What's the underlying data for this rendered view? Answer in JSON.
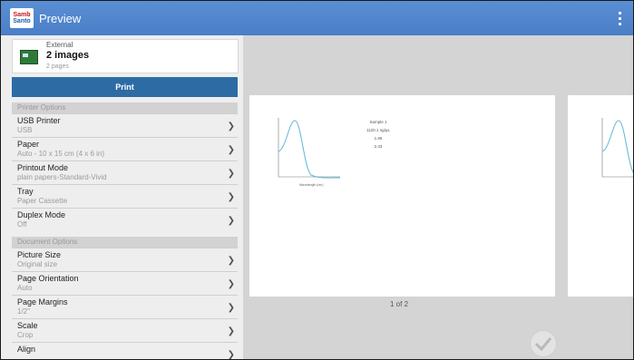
{
  "app": {
    "logo_line1": "Samb",
    "logo_line2": "Santo",
    "title": "Preview"
  },
  "source": {
    "kind": "External",
    "count": "2 images",
    "pages": "2 pages"
  },
  "print_label": "Print",
  "sections": {
    "printer_options": "Printer Options",
    "document_options": "Document Options"
  },
  "printer_rows": [
    {
      "label": "USB Printer",
      "value": "USB"
    },
    {
      "label": "Paper",
      "value": "Auto - 10 x 15 cm (4 x 6 in)"
    },
    {
      "label": "Printout Mode",
      "value": "plain papers-Standard-Vivid"
    },
    {
      "label": "Tray",
      "value": "Paper Cassette"
    },
    {
      "label": "Duplex Mode",
      "value": "Off"
    }
  ],
  "document_rows": [
    {
      "label": "Picture Size",
      "value": "Original size"
    },
    {
      "label": "Page Orientation",
      "value": "Auto"
    },
    {
      "label": "Page Margins",
      "value": "1/2\""
    },
    {
      "label": "Scale",
      "value": "Crop"
    },
    {
      "label": "Align",
      "value": ""
    }
  ],
  "preview": {
    "page_indicator": "1 of 2",
    "sample_label": "Sample 1",
    "sample_value": "1120.1 ng/µL",
    "sample_value2": "1.86",
    "sample_value3": "2.33"
  },
  "colors": {
    "appbar": "#4a7ec7",
    "print_button": "#2d6ba5",
    "chart_line": "#5fb6d6"
  }
}
